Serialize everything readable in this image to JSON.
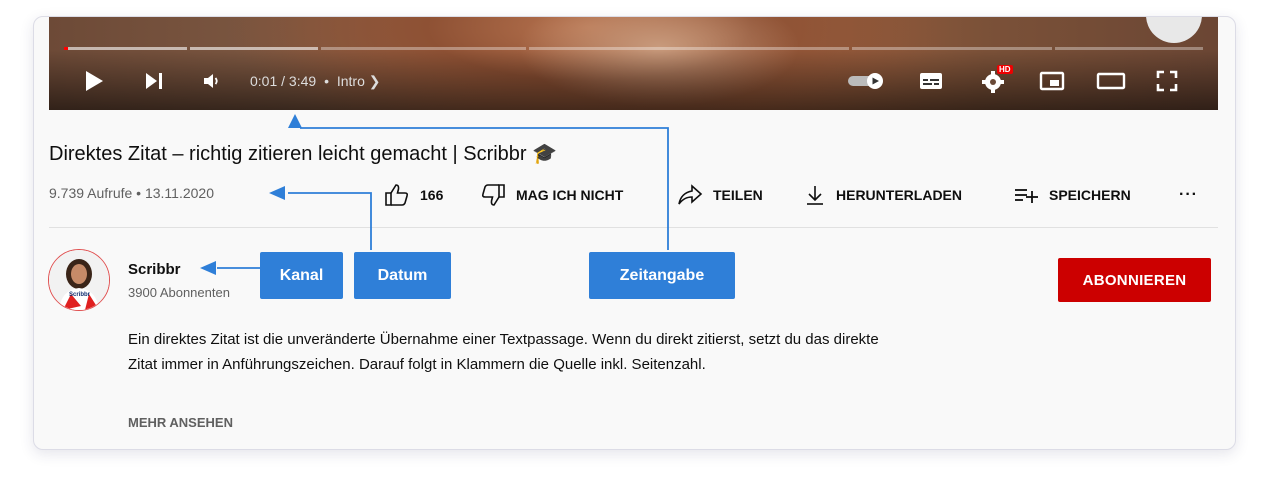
{
  "player": {
    "time": "0:01 / 3:49",
    "chapter": "Intro",
    "hd_badge": "HD",
    "icons": [
      "play-icon",
      "next-icon",
      "volume-icon",
      "autoplay-toggle-icon",
      "subtitles-icon",
      "settings-icon",
      "miniplayer-icon",
      "theater-icon",
      "fullscreen-icon"
    ],
    "progress_fraction": 0.003
  },
  "video": {
    "title": "Direktes Zitat – richtig zitieren leicht gemacht | Scribbr 🎓",
    "views_date": "9.739 Aufrufe • 13.11.2020"
  },
  "actions": {
    "like_count": "166",
    "dislike_label": "MAG ICH NICHT",
    "share_label": "TEILEN",
    "download_label": "HERUNTERLADEN",
    "save_label": "SPEICHERN",
    "more_label": "···"
  },
  "channel": {
    "name": "Scribbr",
    "subscribers": "3900 Abonnenten",
    "subscribe_label": "ABONNIEREN",
    "avatar_text": "Scribbr"
  },
  "description": {
    "text": "Ein direktes Zitat ist die unveränderte Übernahme einer Textpassage. Wenn du direkt zitierst, setzt du das direkte Zitat immer in Anführungszeichen. Darauf folgt in Klammern die Quelle inkl. Seitenzahl.",
    "more_label": "MEHR ANSEHEN"
  },
  "annotations": {
    "kanal": "Kanal",
    "datum": "Datum",
    "zeitangabe": "Zeitangabe",
    "accent": "#2f7fd8"
  },
  "colors": {
    "subscribe_bg": "#cc0000",
    "progress_played": "#ff0000"
  }
}
